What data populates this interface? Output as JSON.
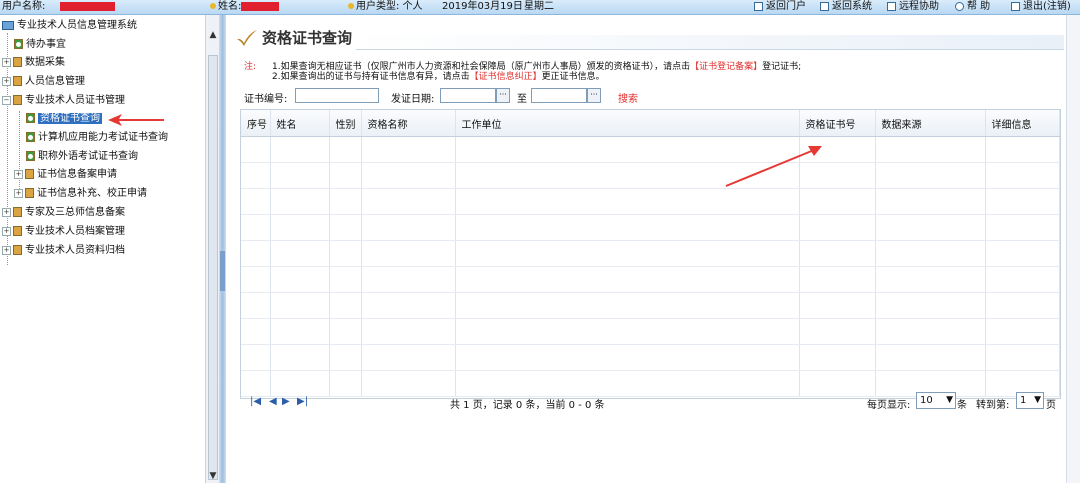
{
  "topbar": {
    "user_account_label": "用户名称:",
    "name_label": "姓名:",
    "user_type_label": "用户类型:",
    "user_type_value": "个人",
    "date": "2019年03月19日",
    "weekday": "星期二",
    "buttons": [
      "返回门户",
      "返回系统",
      "远程协助",
      "帮 助",
      "退出(注销)"
    ]
  },
  "tree": {
    "root": "专业技术人员信息管理系统",
    "items": [
      {
        "label": "待办事宜"
      },
      {
        "label": "数据采集"
      },
      {
        "label": "人员信息管理"
      },
      {
        "label": "专业技术人员证书管理"
      },
      {
        "label": "资格证书查询"
      },
      {
        "label": "计算机应用能力考试证书查询"
      },
      {
        "label": "职称外语考试证书查询"
      },
      {
        "label": "证书信息备案申请"
      },
      {
        "label": "证书信息补充、校正申请"
      },
      {
        "label": "专家及三总师信息备案"
      },
      {
        "label": "专业技术人员档案管理"
      },
      {
        "label": "专业技术人员资料归档"
      }
    ]
  },
  "main": {
    "title": "资格证书查询",
    "note_label": "注:",
    "note1_a": "1.如果查询无相应证书（仅限广州市人力资源和社会保障局（原广州市人事局）颁发的资格证书），请点击",
    "note1_link": "【证书登记备案】",
    "note1_b": "登记证书;",
    "note2_a": "2.如果查询出的证书与持有证书信息有异，请点击",
    "note2_link": "【证书信息纠正】",
    "note2_b": "更正证书信息。",
    "cert_no_label": "证书编号:",
    "issue_date_label": "发证日期:",
    "to_label": "至",
    "search_label": "搜索",
    "columns": [
      "序号",
      "姓名",
      "性别",
      "资格名称",
      "工作单位",
      "资格证书号",
      "数据来源",
      "详细信息"
    ],
    "pager": {
      "info": "共 1 页，记录 0 条，当前 0 - 0 条",
      "per_page_label": "每页显示:",
      "per_page_value": "10",
      "per_page_unit": "条",
      "goto_label": "转到第:",
      "goto_value": "1",
      "goto_unit": "页"
    }
  },
  "colors": {
    "accent": "#2f6fbf",
    "link_red": "#e0302e",
    "annotation": "#e53935"
  }
}
